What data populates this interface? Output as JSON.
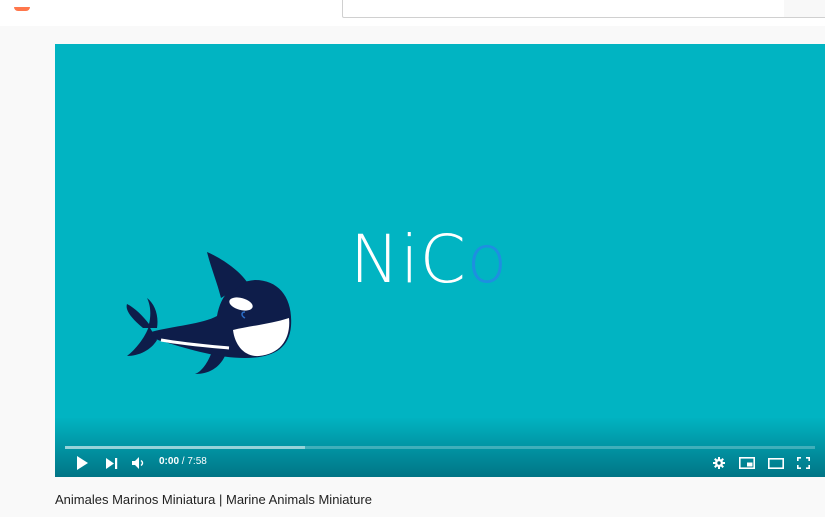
{
  "header": {
    "logo_icon": "youtube-logo-icon",
    "search": {
      "value": "",
      "placeholder": ""
    }
  },
  "player": {
    "background_color": "#01b4c2",
    "brand": {
      "part_a": "N",
      "part_b": "iC",
      "part_c": "o"
    },
    "character_icon": "orca-icon",
    "current_time": "0:00",
    "separator": " / ",
    "duration": "7:58",
    "loaded_fraction": 0.32,
    "controls": {
      "play_icon": "play-icon",
      "next_icon": "next-icon",
      "volume_icon": "volume-icon",
      "settings_icon": "gear-icon",
      "miniplayer_icon": "miniplayer-icon",
      "theater_icon": "theater-mode-icon",
      "fullscreen_icon": "fullscreen-icon"
    }
  },
  "video": {
    "title": "Animales Marinos Miniatura | Marine Animals Miniature"
  }
}
